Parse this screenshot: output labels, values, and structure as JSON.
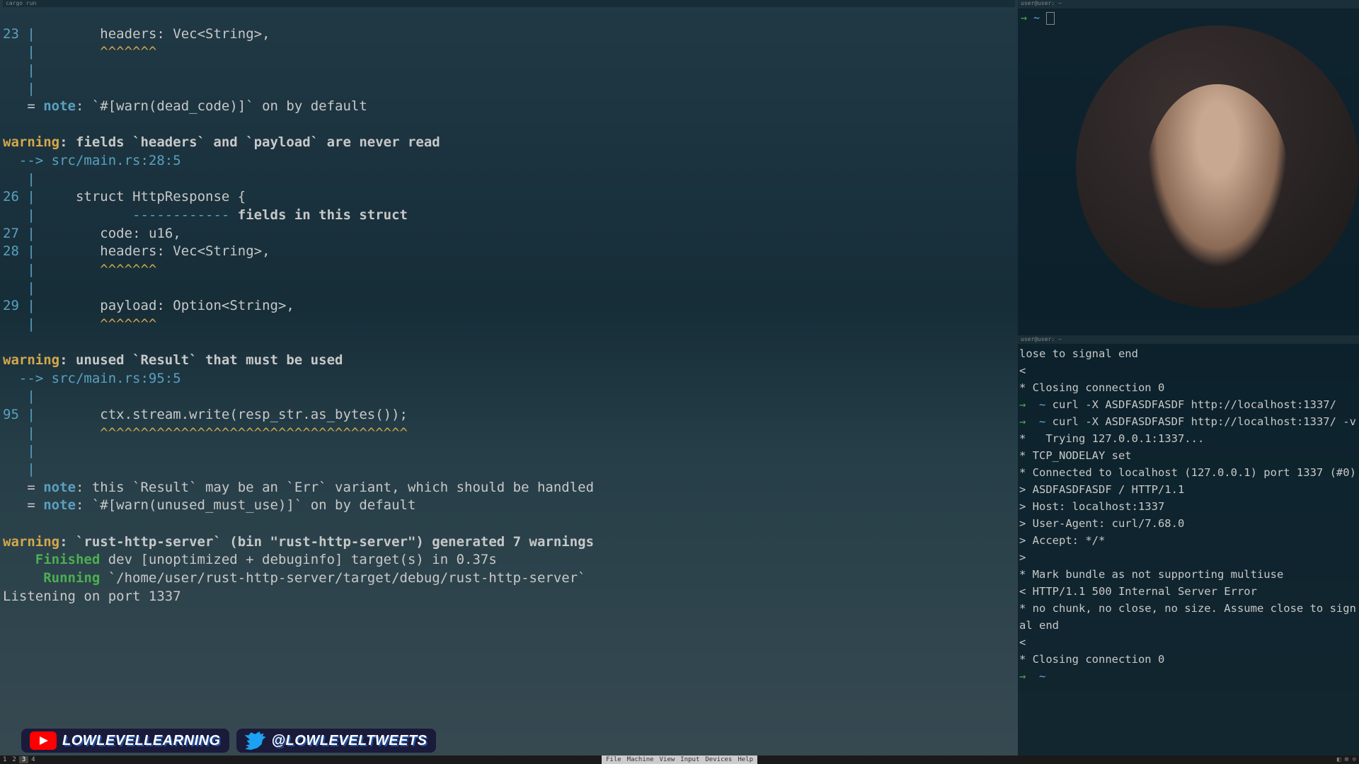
{
  "term_left": {
    "title": "cargo run",
    "lines": {
      "l23_num": "23",
      "l23_code": "        headers: Vec<String>,",
      "l23_under": "        ^^^^^^^",
      "note1_eq": "   =",
      "note1_label": "note",
      "note1_text": ": `#[warn(dead_code)]` on by default",
      "warn2_label": "warning",
      "warn2_text": ": fields `headers` and `payload` are never read",
      "warn2_loc": "  --> src/main.rs:28:5",
      "l26_num": "26",
      "l26_code": "     struct HttpResponse {",
      "l26_dash": "            ------------",
      "l26_msg": " fields in this struct",
      "l27_num": "27",
      "l27_code": "        code: u16,",
      "l28_num": "28",
      "l28_code": "        headers: Vec<String>,",
      "l28_under": "        ^^^^^^^",
      "l29_num": "29",
      "l29_code": "        payload: Option<String>,",
      "l29_under": "        ^^^^^^^",
      "warn3_label": "warning",
      "warn3_text": ": unused `Result` that must be used",
      "warn3_loc": "  --> src/main.rs:95:5",
      "l95_num": "95",
      "l95_code": "        ctx.stream.write(resp_str.as_bytes());",
      "l95_under": "        ^^^^^^^^^^^^^^^^^^^^^^^^^^^^^^^^^^^^^^",
      "note3a_label": "note",
      "note3a_text": ": this `Result` may be an `Err` variant, which should be handled",
      "note3b_label": "note",
      "note3b_text": ": `#[warn(unused_must_use)]` on by default",
      "warn4_label": "warning",
      "warn4_text": ": `rust-http-server` (bin \"rust-http-server\") generated 7 warnings",
      "finished_label": "    Finished",
      "finished_text": " dev [unoptimized + debuginfo] target(s) in 0.37s",
      "running_label": "     Running",
      "running_text": " `/home/user/rust-http-server/target/debug/rust-http-server`",
      "listening": "Listening on port 1337"
    }
  },
  "term_tr": {
    "title": "user@user: ~",
    "prompt_arrow": "→",
    "prompt_tilde": " ~ "
  },
  "term_br": {
    "title": "user@user: ~",
    "lines": [
      "lose to signal end",
      "< ",
      "* Closing connection 0",
      "→  ~ curl -X ASDFASDFASDF http://localhost:1337/",
      "→  ~ curl -X ASDFASDFASDF http://localhost:1337/ -v",
      "*   Trying 127.0.0.1:1337...",
      "* TCP_NODELAY set",
      "* Connected to localhost (127.0.0.1) port 1337 (#0)",
      "> ASDFASDFASDF / HTTP/1.1",
      "> Host: localhost:1337",
      "> User-Agent: curl/7.68.0",
      "> Accept: */*",
      "> ",
      "* Mark bundle as not supporting multiuse",
      "< HTTP/1.1 500 Internal Server Error",
      "* no chunk, no close, no size. Assume close to signal end",
      "< ",
      "* Closing connection 0",
      "→  ~ "
    ]
  },
  "socials": {
    "youtube": "LOWLEVELLEARNING",
    "twitter": "@LOWLEVELTWEETS"
  },
  "taskbar": {
    "workspaces": [
      "1",
      "2",
      "3",
      "4"
    ],
    "active_ws": "3",
    "menu": [
      "File",
      "Machine",
      "View",
      "Input",
      "Devices",
      "Help"
    ],
    "right_icons": "◧ ⊞ ⊙"
  },
  "colors": {
    "warn": "#d4a84a",
    "info": "#5aa0c0",
    "ok": "#4caf50",
    "text": "#c8c8c8"
  }
}
